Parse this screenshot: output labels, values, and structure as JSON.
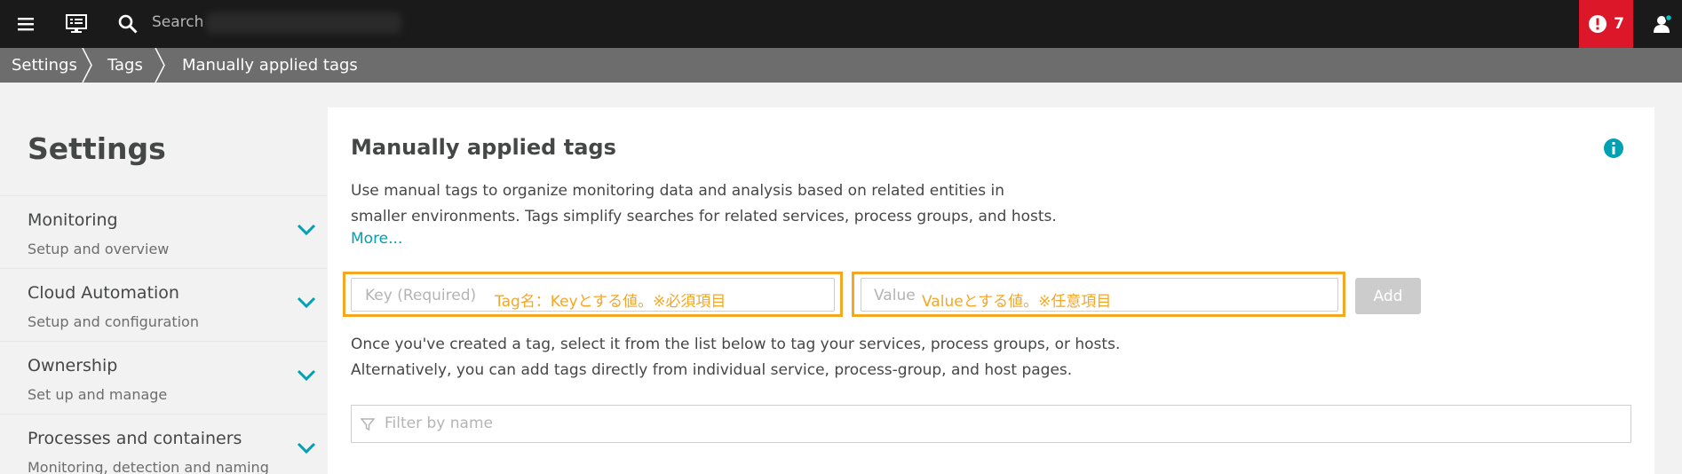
{
  "topbar": {
    "search_label": "Search",
    "alert_count": "7",
    "icons": [
      "menu-icon",
      "monitor-icon",
      "search-icon",
      "alert-icon",
      "user-icon"
    ]
  },
  "breadcrumb": [
    "Settings",
    "Tags",
    "Manually applied tags"
  ],
  "sidebar": {
    "title": "Settings",
    "items": [
      {
        "label": "Monitoring",
        "sub": "Setup and overview"
      },
      {
        "label": "Cloud Automation",
        "sub": "Setup and configuration"
      },
      {
        "label": "Ownership",
        "sub": "Set up and manage"
      },
      {
        "label": "Processes and containers",
        "sub": "Monitoring, detection and naming"
      }
    ]
  },
  "main": {
    "title": "Manually applied tags",
    "desc_line1": "Use manual tags to organize monitoring data and analysis based on related entities in",
    "desc_line2": "smaller environments. Tags simplify searches for related services, process groups, and hosts.",
    "more": "More...",
    "key_placeholder": "Key (Required)",
    "key_note": "Tag名：Keyとする値。※必須項目",
    "value_placeholder": "Value",
    "value_note": "Valueとする値。※任意項目",
    "add_label": "Add",
    "help_line1": "Once you've created a tag, select it from the list below to tag your services, process groups, or hosts.",
    "help_line2": "Alternatively, you can add tags directly from individual service, process-group, and host pages.",
    "filter_placeholder": "Filter by name"
  },
  "colors": {
    "accent": "#00a1b2",
    "alert": "#dc172a",
    "highlight": "#f5a623",
    "topbar": "#1a1a1a",
    "breadcrumb": "#6d6d6d"
  }
}
